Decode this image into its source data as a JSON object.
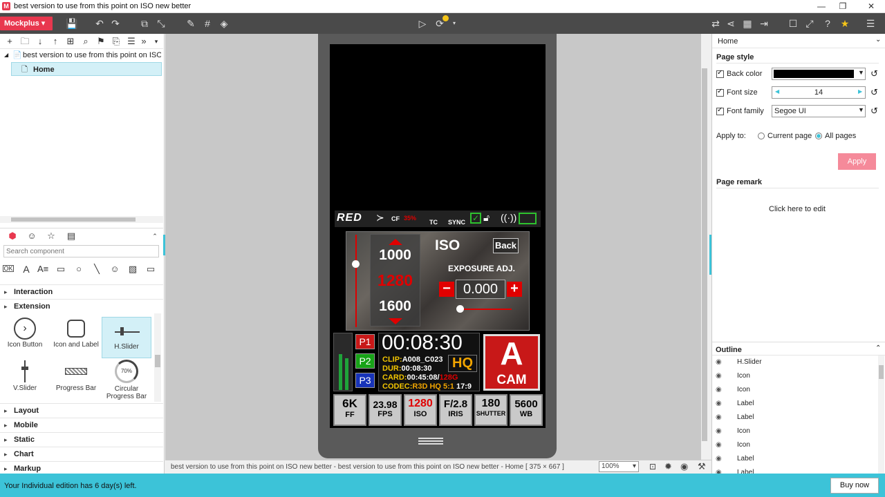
{
  "window": {
    "title": "best version to use from this point on ISO new better",
    "logo": "M"
  },
  "toolbar": {
    "brand": "Mockplus"
  },
  "tree": {
    "project": "best version to use from this point on ISO new better",
    "page": "Home"
  },
  "components": {
    "search_placeholder": "Search component",
    "sections": [
      "Interaction",
      "Extension",
      "Layout",
      "Mobile",
      "Static",
      "Chart",
      "Markup"
    ],
    "items": [
      "Icon Button",
      "Icon and Label",
      "H.Slider",
      "V.Slider",
      "Progress Bar",
      "Circular Progress Bar"
    ],
    "progress_value": "70%"
  },
  "camera": {
    "top_bar": {
      "brand": "RED",
      "cf": "CF",
      "cf_pct": "35%",
      "tc": "TC",
      "sync": "SYNC"
    },
    "iso_panel": {
      "val_top": "1000",
      "val_mid": "1280",
      "val_bot": "1600",
      "title": "ISO",
      "back": "Back",
      "exposure": "EXPOSURE ADJ.",
      "exposure_val": "0.000",
      "minus": "−",
      "plus": "+"
    },
    "presets": [
      "P1",
      "P2",
      "P3"
    ],
    "timecode": "00:08:30",
    "clip_label": "CLIP:",
    "clip_val": "A008_C023",
    "dur_label": "DUR:",
    "dur_val": "00:08:30",
    "card_label": "CARD:",
    "card_val": "00:45:08/",
    "card_size": "128G",
    "codec_label": "CODEC:",
    "codec_val": "R3D HQ 5:1",
    "codec_ratio": "17:9",
    "hq": "HQ",
    "cam_letter": "A",
    "cam_word": "CAM",
    "bottom": [
      {
        "value": "6K",
        "label": "FF"
      },
      {
        "value": "23.98",
        "label": "FPS"
      },
      {
        "value": "1280",
        "label": "ISO"
      },
      {
        "value": "F/2.8",
        "label": "IRIS"
      },
      {
        "value": "180",
        "label": "SHUTTER"
      },
      {
        "value": "5600",
        "label": "WB"
      }
    ]
  },
  "status": {
    "text": "best version to use from this point on ISO new better - best version to use from this point on ISO new better - Home [ 375 × 667 ]",
    "zoom": "100%"
  },
  "props": {
    "page_name": "Home",
    "page_style": "Page style",
    "back_color": "Back color",
    "font_size_label": "Font size",
    "font_size": "14",
    "font_family_label": "Font family",
    "font_family": "Segoe UI",
    "apply_to": "Apply to:",
    "current_page": "Current page",
    "all_pages": "All pages",
    "apply": "Apply",
    "page_remark": "Page remark",
    "click_edit": "Click here to edit",
    "outline": "Outline",
    "outline_items": [
      "H.Slider",
      "Icon",
      "Icon",
      "Label",
      "Label",
      "Icon",
      "Icon",
      "Label",
      "Label"
    ]
  },
  "footer": {
    "trial": "Your Individual edition has 6 day(s) left.",
    "buy": "Buy now"
  },
  "colors": {
    "brand": "#e8384f",
    "accent": "#3cc3d8",
    "red": "#e00000"
  }
}
